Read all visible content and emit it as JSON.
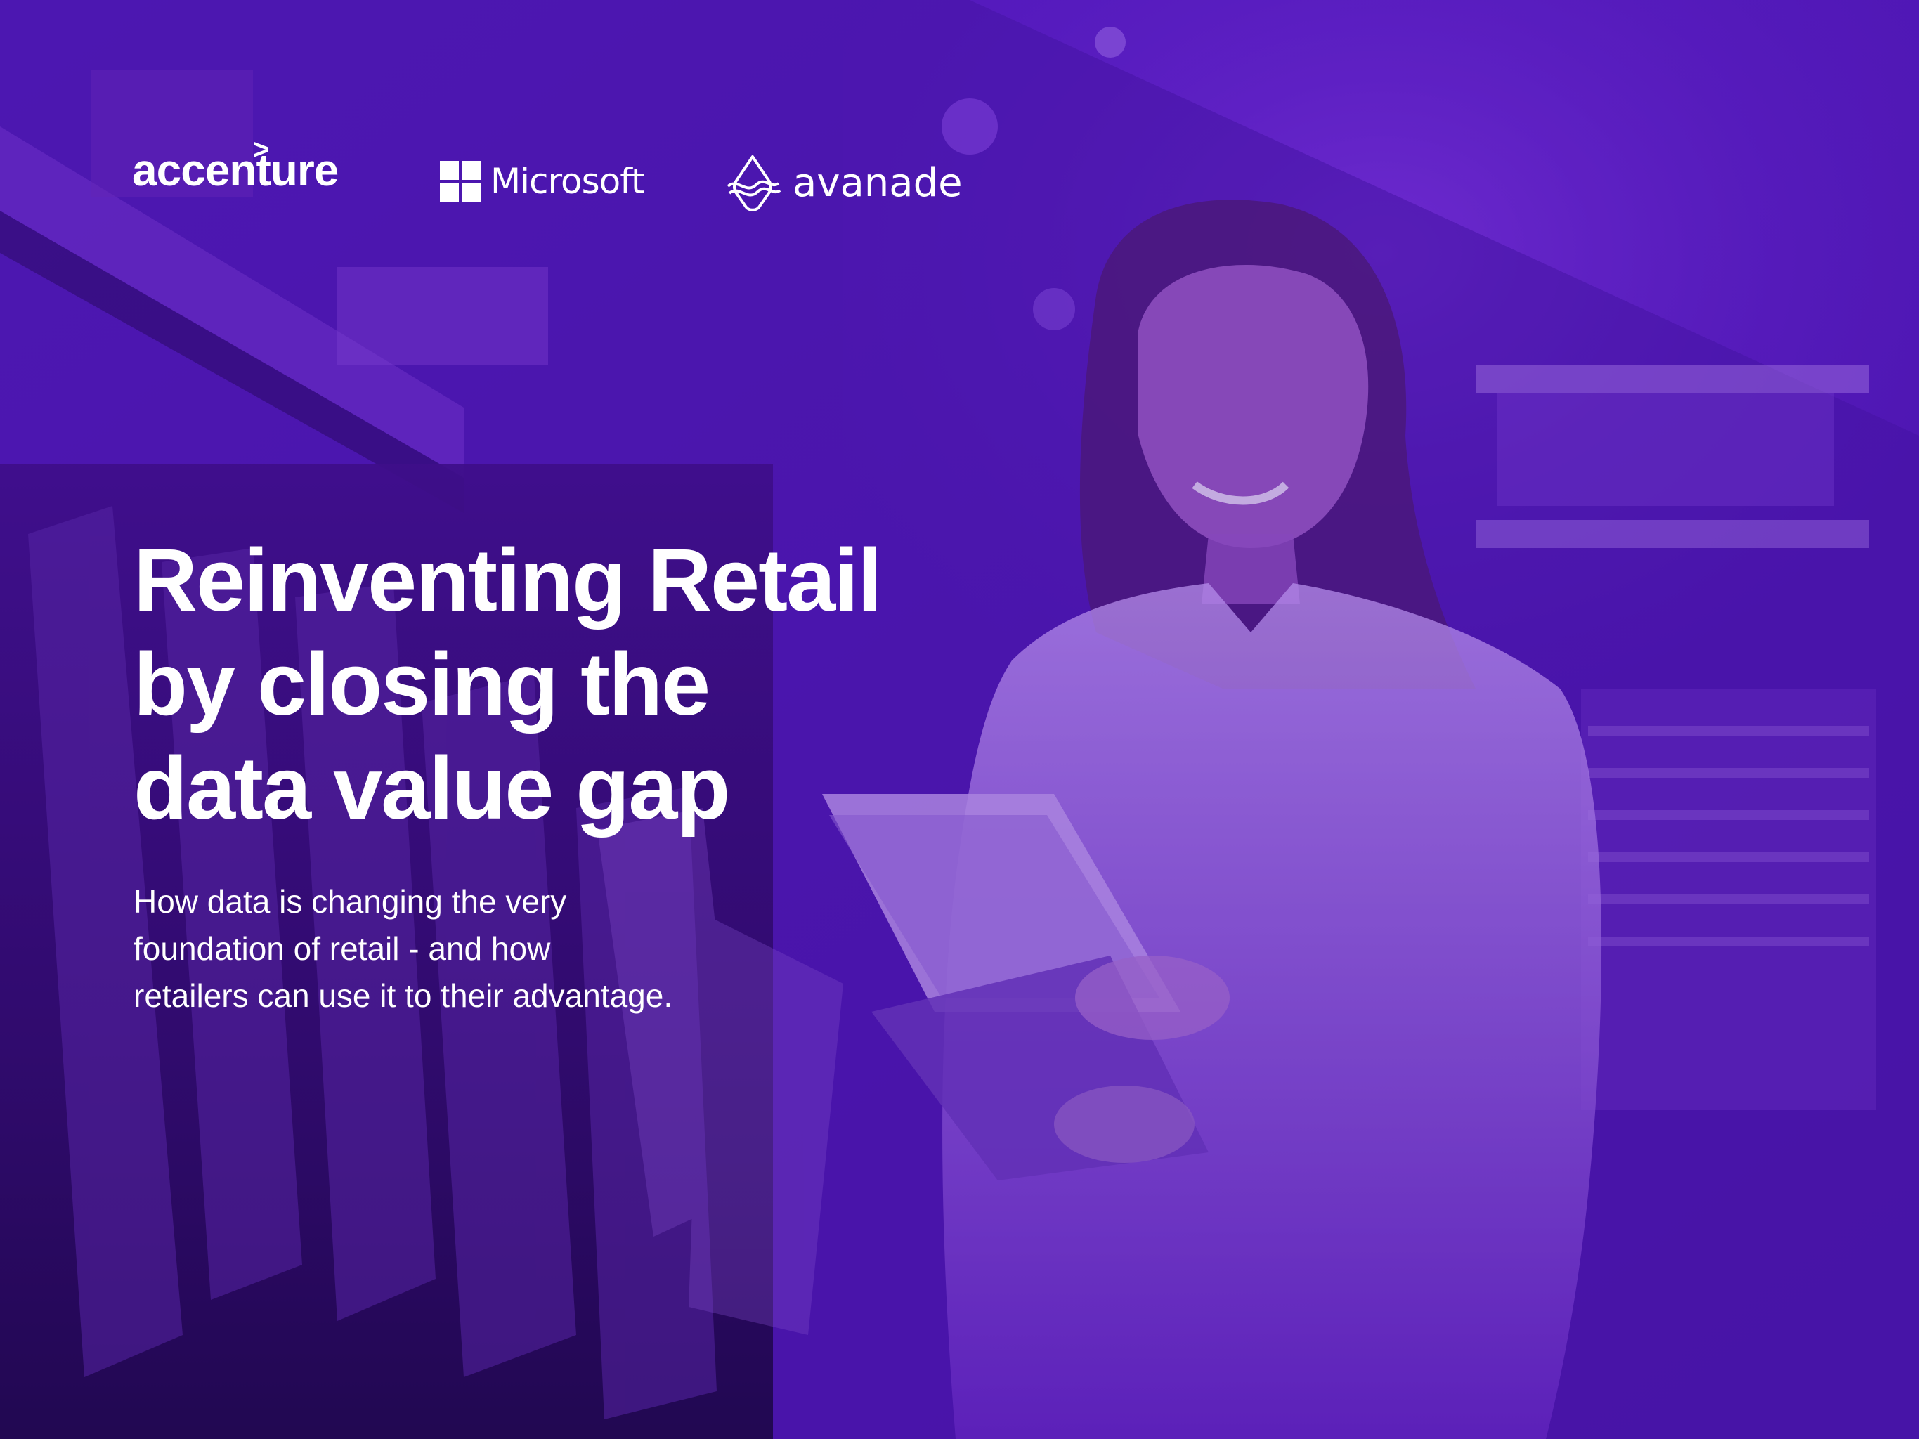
{
  "logos": {
    "accenture": "accenture",
    "accenture_mark": ">",
    "microsoft": "Microsoft",
    "avanade": "avanade"
  },
  "cover": {
    "title_lines": [
      "Reinventing Retail",
      "by closing the",
      "data value gap"
    ],
    "subtitle_lines": [
      "How data is changing the very",
      "foundation of retail - and how",
      "retailers can use it to their advantage."
    ]
  },
  "colors": {
    "overlay_purple": "#4b13a8",
    "deep_purple": "#1a0640",
    "text": "#ffffff"
  },
  "icons": [
    "microsoft-logo-icon",
    "avanade-logo-icon"
  ]
}
